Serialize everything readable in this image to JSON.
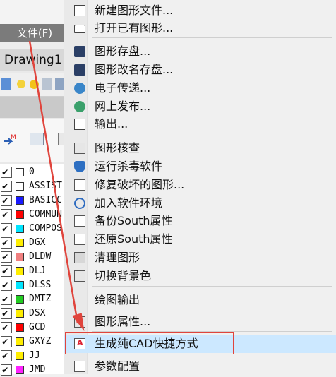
{
  "app": {
    "file_menu_label": "文件(F)",
    "drawing_tab": "Drawing1"
  },
  "layers": [
    {
      "name": "0",
      "color": "#ffffff"
    },
    {
      "name": "ASSIST",
      "color": "#ffffff"
    },
    {
      "name": "BASICC",
      "color": "#1a1aff"
    },
    {
      "name": "COMMUN",
      "color": "#ff0000"
    },
    {
      "name": "COMPOS",
      "color": "#00e5ff"
    },
    {
      "name": "DGX",
      "color": "#ffee00"
    },
    {
      "name": "DLDW",
      "color": "#f08080"
    },
    {
      "name": "DLJ",
      "color": "#ffee00"
    },
    {
      "name": "DLSS",
      "color": "#00e5ff"
    },
    {
      "name": "DMTZ",
      "color": "#22cc22"
    },
    {
      "name": "DSX",
      "color": "#ffee00"
    },
    {
      "name": "GCD",
      "color": "#ff0000"
    },
    {
      "name": "GXYZ",
      "color": "#ffee00"
    },
    {
      "name": "JJ",
      "color": "#ffee00"
    },
    {
      "name": "JMD",
      "color": "#ff22ff"
    }
  ],
  "menu": {
    "items": [
      {
        "label": "新建图形文件...",
        "icon": "new-document-icon"
      },
      {
        "label": "打开已有图形...",
        "icon": "open-folder-icon"
      },
      {
        "label": "图形存盘...",
        "icon": "save-disk-icon"
      },
      {
        "label": "图形改名存盘...",
        "icon": "save-as-icon"
      },
      {
        "label": "电子传递...",
        "icon": "etransmit-icon"
      },
      {
        "label": "网上发布...",
        "icon": "publish-web-icon"
      },
      {
        "label": "输出...",
        "icon": "export-icon"
      },
      {
        "label": "图形核查",
        "icon": "audit-icon"
      },
      {
        "label": "运行杀毒软件",
        "icon": "antivirus-shield-icon"
      },
      {
        "label": "修复破坏的图形...",
        "icon": "repair-icon"
      },
      {
        "label": "加入软件环境",
        "icon": "add-environment-icon"
      },
      {
        "label": "备份South属性",
        "icon": "backup-properties-icon"
      },
      {
        "label": "还原South属性",
        "icon": "restore-properties-icon"
      },
      {
        "label": "清理图形",
        "icon": "purge-trash-icon"
      },
      {
        "label": "切换背景色",
        "icon": "background-color-icon"
      },
      {
        "label": "绘图输出",
        "icon": ""
      },
      {
        "label": "图形属性...",
        "icon": "drawing-properties-icon"
      },
      {
        "label": "生成纯CAD快捷方式",
        "icon": "cad-shortcut-icon"
      },
      {
        "label": "参数配置",
        "icon": "settings-sliders-icon"
      }
    ]
  },
  "colors": {
    "highlight_box": "#e0443c",
    "arrow": "#e0443c",
    "selected_item": "#cce8ff"
  }
}
